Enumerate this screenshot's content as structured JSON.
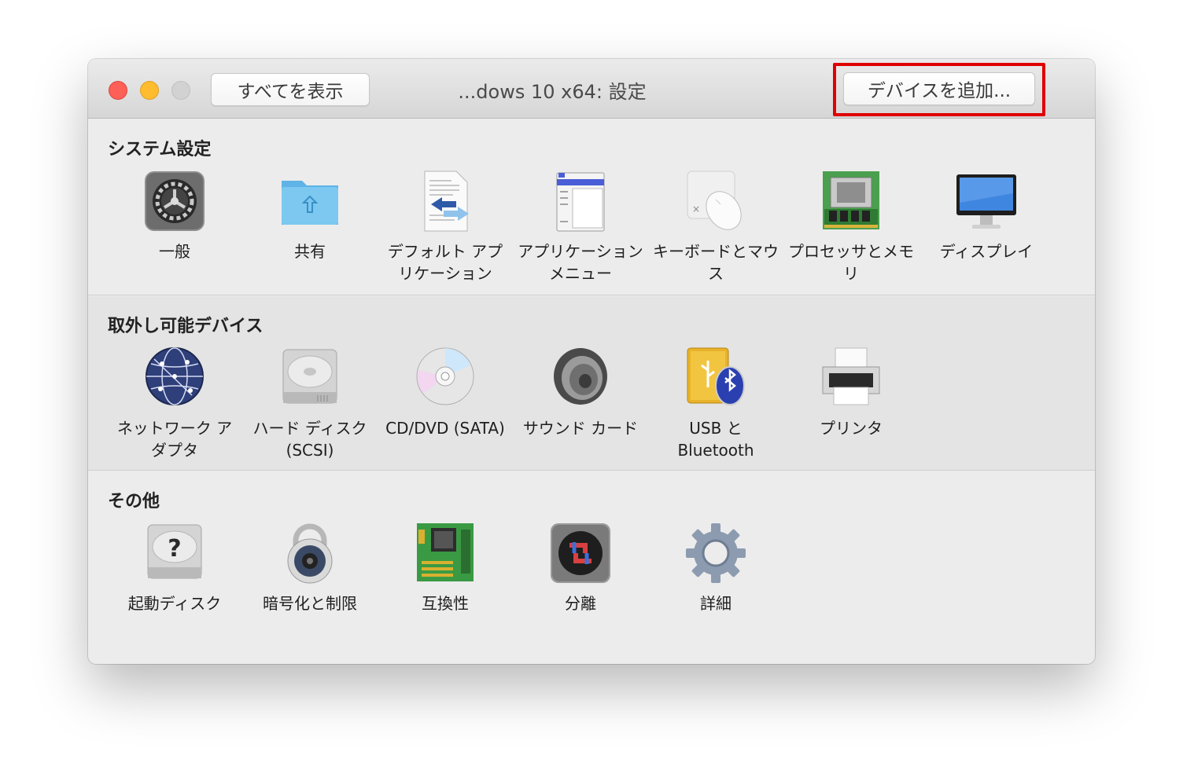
{
  "window": {
    "title": "...dows 10 x64: 設定",
    "show_all_button": "すべてを表示",
    "add_device_button": "デバイスを追加..."
  },
  "sections": [
    {
      "title": "システム設定",
      "items": [
        {
          "label": "一般",
          "icon": "general-gear-icon"
        },
        {
          "label": "共有",
          "icon": "shared-folder-icon"
        },
        {
          "label": "デフォルト アプリケーション",
          "icon": "default-app-document-icon"
        },
        {
          "label": "アプリケーション メニュー",
          "icon": "app-menu-window-icon"
        },
        {
          "label": "キーボードとマウス",
          "icon": "keyboard-mouse-icon"
        },
        {
          "label": "プロセッサとメモリ",
          "icon": "processor-memory-icon"
        },
        {
          "label": "ディスプレイ",
          "icon": "display-monitor-icon"
        }
      ]
    },
    {
      "title": "取外し可能デバイス",
      "items": [
        {
          "label": "ネットワーク アダプタ",
          "icon": "network-globe-icon"
        },
        {
          "label": "ハード ディスク (SCSI)",
          "icon": "hard-disk-icon"
        },
        {
          "label": "CD/DVD (SATA)",
          "icon": "cd-dvd-icon"
        },
        {
          "label": "サウンド カード",
          "icon": "speaker-icon"
        },
        {
          "label": "USB と Bluetooth",
          "icon": "usb-bluetooth-icon"
        },
        {
          "label": "プリンタ",
          "icon": "printer-icon"
        }
      ]
    },
    {
      "title": "その他",
      "items": [
        {
          "label": "起動ディスク",
          "icon": "boot-disk-icon"
        },
        {
          "label": "暗号化と制限",
          "icon": "padlock-icon"
        },
        {
          "label": "互換性",
          "icon": "circuit-board-icon"
        },
        {
          "label": "分離",
          "icon": "isolation-icon"
        },
        {
          "label": "詳細",
          "icon": "advanced-gear-icon"
        }
      ]
    }
  ],
  "colors": {
    "highlight": "#e00000",
    "close": "#fe5f57",
    "minimize": "#febc2e"
  }
}
